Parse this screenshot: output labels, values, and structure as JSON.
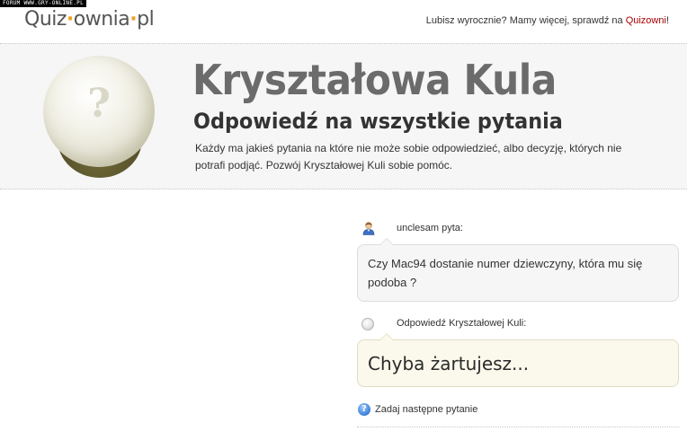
{
  "forum_tag": "FORUM WWW.GRY-ONLINE.PL",
  "logo": {
    "part1": "Quiz",
    "sep1": "·",
    "part2": "ownia",
    "sep2": "·",
    "part3": "pl"
  },
  "promo": {
    "text": "Lubisz wyrocznie? Mamy więcej, sprawdź na ",
    "link": "Quizowni",
    "suffix": "!"
  },
  "banner": {
    "title": "Kryształowa Kula",
    "subtitle": "Odpowiedź na wszystkie pytania",
    "description": "Każdy ma jakieś pytania na które nie może sobie odpowiedzieć, albo decyzję, których nie potrafi podjąć. Pozwój Kryształowej Kuli sobie pomóc.",
    "ball_mark": "?"
  },
  "question": {
    "asker_label": "unclesam pyta:",
    "text": "Czy Mac94 dostanie numer dziewczyny, która mu się podoba ?"
  },
  "answer": {
    "label": "Odpowiedź Kryształowej Kuli:",
    "text": "Chyba żartujesz..."
  },
  "next_question": {
    "icon_mark": "?",
    "label": "Zadaj następne pytanie"
  },
  "colors": {
    "accent_link": "#a80000",
    "logo_dot": "#f0a020",
    "ball_base": "#55502a"
  }
}
